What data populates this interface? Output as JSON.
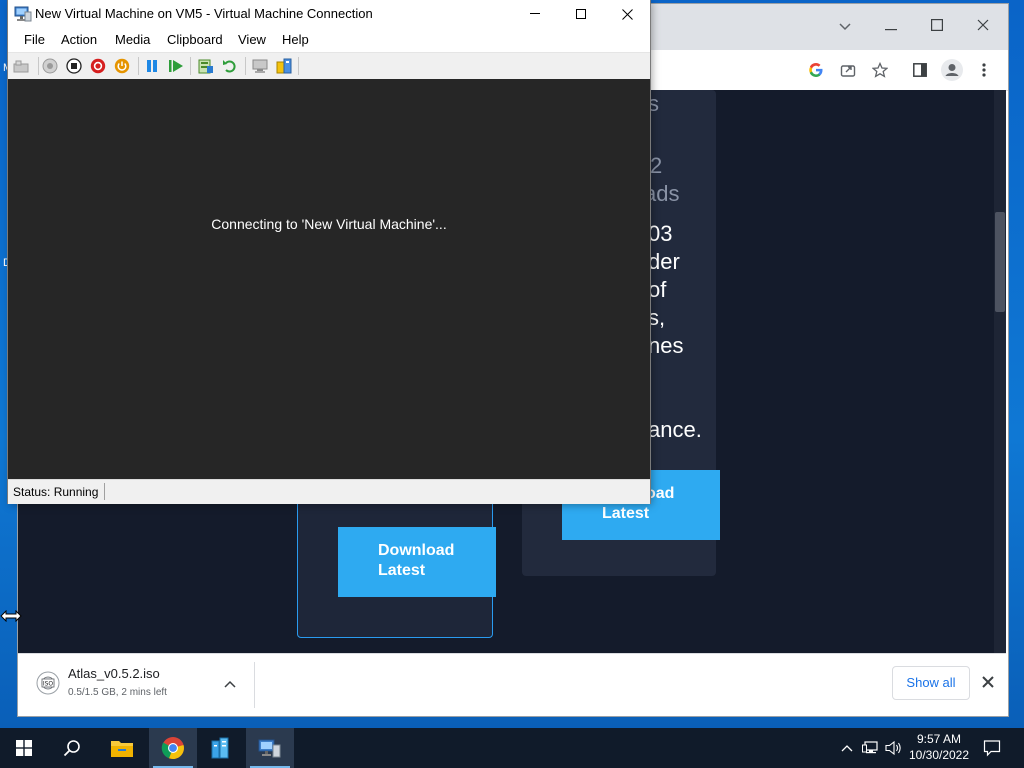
{
  "vm_window": {
    "title": "New Virtual Machine on VM5 - Virtual Machine Connection",
    "menu": [
      "File",
      "Action",
      "Media",
      "Clipboard",
      "View",
      "Help"
    ],
    "toolbar_icons": [
      "ctrl-alt-del-icon",
      "start-icon",
      "turn-off-icon",
      "shutdown-icon",
      "power-icon",
      "pause-icon",
      "resume-icon",
      "checkpoint-icon",
      "revert-icon",
      "enhanced-session-icon",
      "share-icon"
    ],
    "screen_message": "Connecting to 'New Virtual Machine'...",
    "status": "Status: Running",
    "colors": {
      "screen": "#262626",
      "pause": "#1e88e5",
      "resume": "#2e9d3a",
      "turnoff": "#d61f1f",
      "power": "#e59400"
    }
  },
  "browser": {
    "page_fragments": {
      "col2_a": "2",
      "col2_b": "ads",
      "col2_c": "03",
      "col2_d": "der",
      "col2_e": "of",
      "col2_f": "s,",
      "col2_g": "nes",
      "col2_h": "ance.",
      "col2_btn": "oad\nLatest",
      "col2_btn_line1": "oad",
      "col2_btn_line2": "Latest",
      "col1_btn_line1": "Download",
      "col1_btn_line2": "Latest"
    },
    "download": {
      "filename": "Atlas_v0.5.2.iso",
      "status": "0.5/1.5 GB, 2 mins left",
      "show_all": "Show all"
    },
    "colors": {
      "page_bg": "#141b2b",
      "button": "#2eaaf1",
      "card_border": "#2a9bf0"
    }
  },
  "taskbar": {
    "time": "9:57 AM",
    "date": "10/30/2022",
    "apps": [
      "start-icon",
      "search-icon",
      "file-explorer-icon",
      "chrome-icon",
      "server-manager-icon",
      "hyper-v-icon"
    ]
  }
}
